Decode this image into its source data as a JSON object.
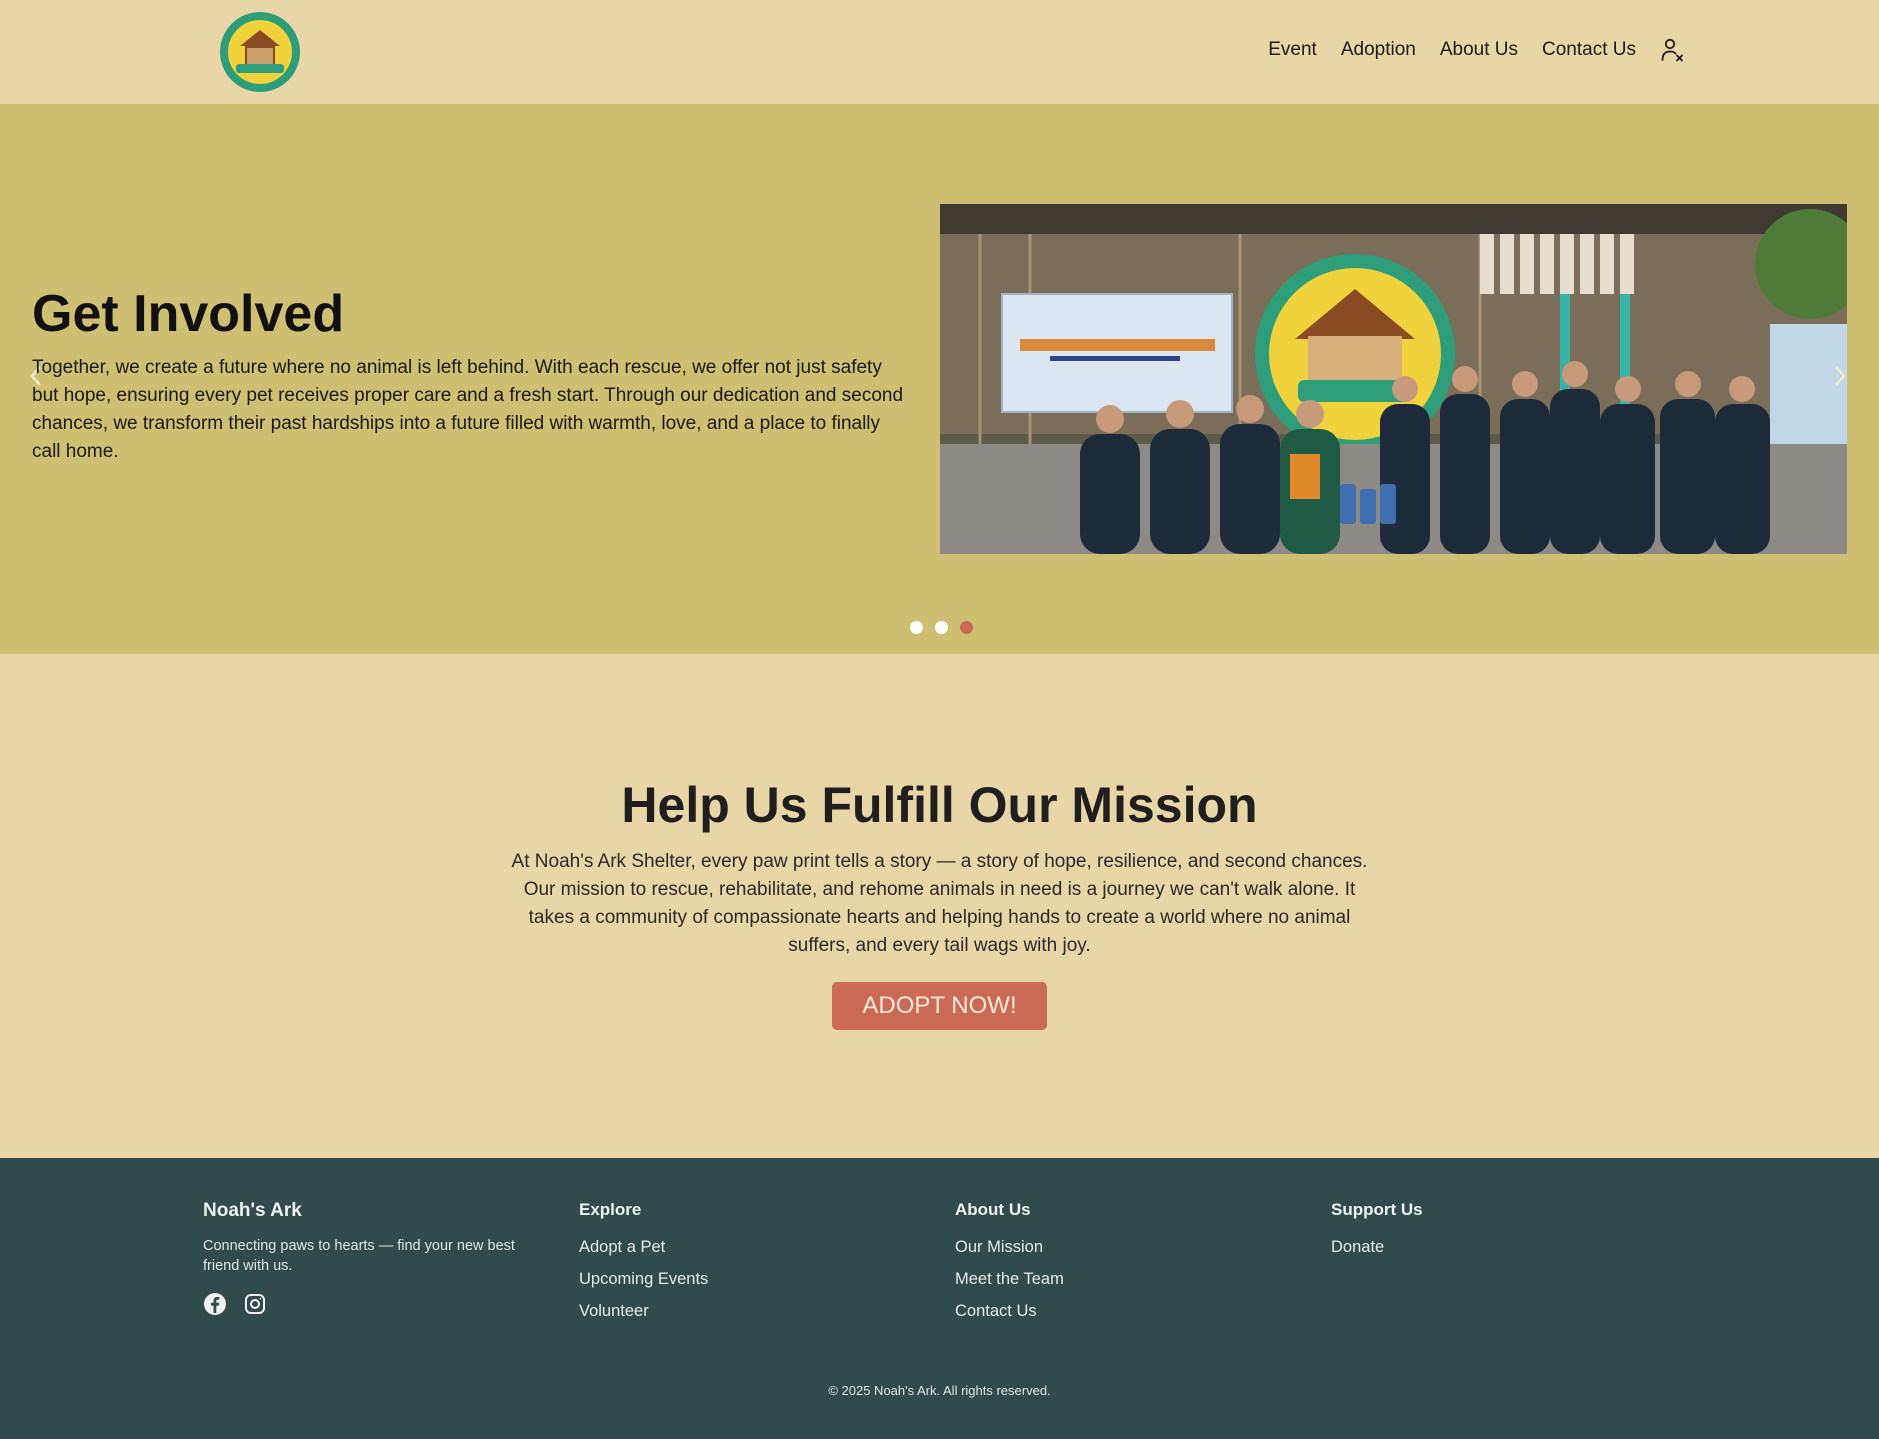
{
  "nav": {
    "links": [
      "Event",
      "Adoption",
      "About Us",
      "Contact Us"
    ],
    "user_icon": "user-x-icon"
  },
  "hero": {
    "title": "Get Involved",
    "text": "Together, we create a future where no animal is left behind. With each rescue, we offer not just safety but hope, ensuring every pet receives proper care and a fresh start. Through our dedication and second chances, we transform their past hardships into a future filled with warmth, love, and a place to finally call home.",
    "prev_icon": "chevron-left-icon",
    "next_icon": "chevron-right-icon",
    "slides_total": 3,
    "active_slide": 3
  },
  "mission": {
    "title": "Help Us Fulfill Our Mission",
    "text": "At Noah's Ark Shelter, every paw print tells a story — a story of hope, resilience, and second chances. Our mission to rescue, rehabilitate, and rehome animals in need is a journey we can't walk alone. It takes a community of compassionate hearts and helping hands to create a world where no animal suffers, and every tail wags with joy.",
    "button_label": "ADOPT NOW!"
  },
  "footer": {
    "brand": "Noah's Ark",
    "tagline": "Connecting paws to hearts — find your new best friend with us.",
    "socials": [
      "facebook-icon",
      "instagram-icon"
    ],
    "columns": [
      {
        "heading": "Explore",
        "items": [
          "Adopt a Pet",
          "Upcoming Events",
          "Volunteer"
        ]
      },
      {
        "heading": "About Us",
        "items": [
          "Our Mission",
          "Meet the Team",
          "Contact Us"
        ]
      },
      {
        "heading": "Support Us",
        "items": [
          "Donate"
        ]
      }
    ],
    "copyright": "© 2025 Noah's Ark. All rights reserved."
  },
  "colors": {
    "page_bg": "#e9d6a7",
    "hero_bg": "#cfbf72",
    "accent": "#cc6a58",
    "footer_bg": "#304b4c"
  }
}
